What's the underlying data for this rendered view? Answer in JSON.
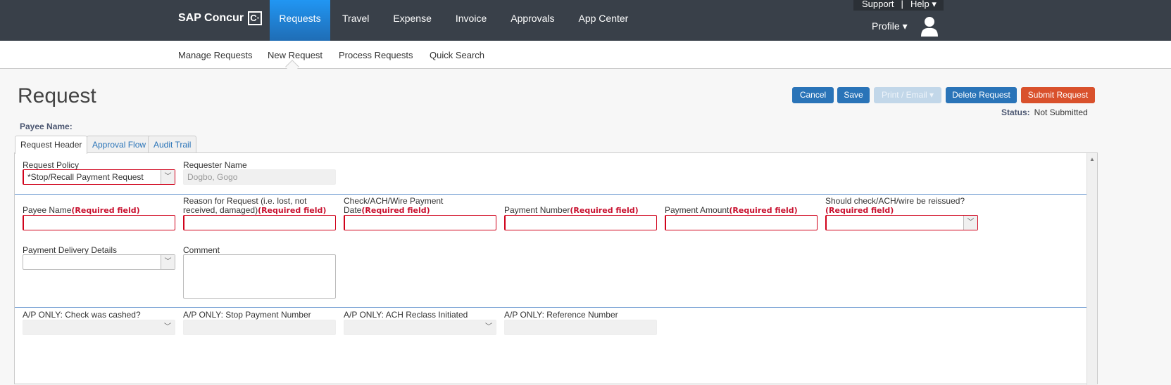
{
  "brand": "SAP Concur",
  "nav": [
    "Requests",
    "Travel",
    "Expense",
    "Invoice",
    "Approvals",
    "App Center"
  ],
  "util": {
    "support": "Support",
    "help": "Help",
    "profile": "Profile"
  },
  "subnav": [
    "Manage Requests",
    "New Request",
    "Process Requests",
    "Quick Search"
  ],
  "page": {
    "title": "Request",
    "payee_label": "Payee Name:",
    "status_label": "Status:",
    "status_value": "Not Submitted"
  },
  "buttons": {
    "cancel": "Cancel",
    "save": "Save",
    "print": "Print / Email",
    "delete": "Delete Request",
    "submit": "Submit Request"
  },
  "tabs": [
    "Request Header",
    "Approval Flow",
    "Audit Trail"
  ],
  "required": "(Required field)",
  "fields": {
    "policy": {
      "label": "Request Policy",
      "value": "*Stop/Recall Payment Request"
    },
    "requester": {
      "label": "Requester Name",
      "value": "Dogbo, Gogo"
    },
    "payee": {
      "label": "Payee Name"
    },
    "reason": {
      "label": "Reason for Request (i.e. lost, not received, damaged)"
    },
    "date": {
      "label": "Check/ACH/Wire Payment Date"
    },
    "number": {
      "label": "Payment Number"
    },
    "amount": {
      "label": "Payment Amount"
    },
    "reissue": {
      "label": "Should check/ACH/wire be reissued?"
    },
    "delivery": {
      "label": "Payment Delivery Details"
    },
    "comment": {
      "label": "Comment"
    },
    "cashed": {
      "label": "A/P ONLY: Check was cashed?"
    },
    "stop": {
      "label": "A/P ONLY: Stop Payment Number"
    },
    "reclass": {
      "label": "A/P ONLY: ACH Reclass Initiated"
    },
    "ref": {
      "label": "A/P ONLY: Reference Number"
    }
  },
  "colors": {
    "topbar": "#394049",
    "accent": "#2a74b8",
    "submit": "#d9512c",
    "required": "#c8102e"
  }
}
